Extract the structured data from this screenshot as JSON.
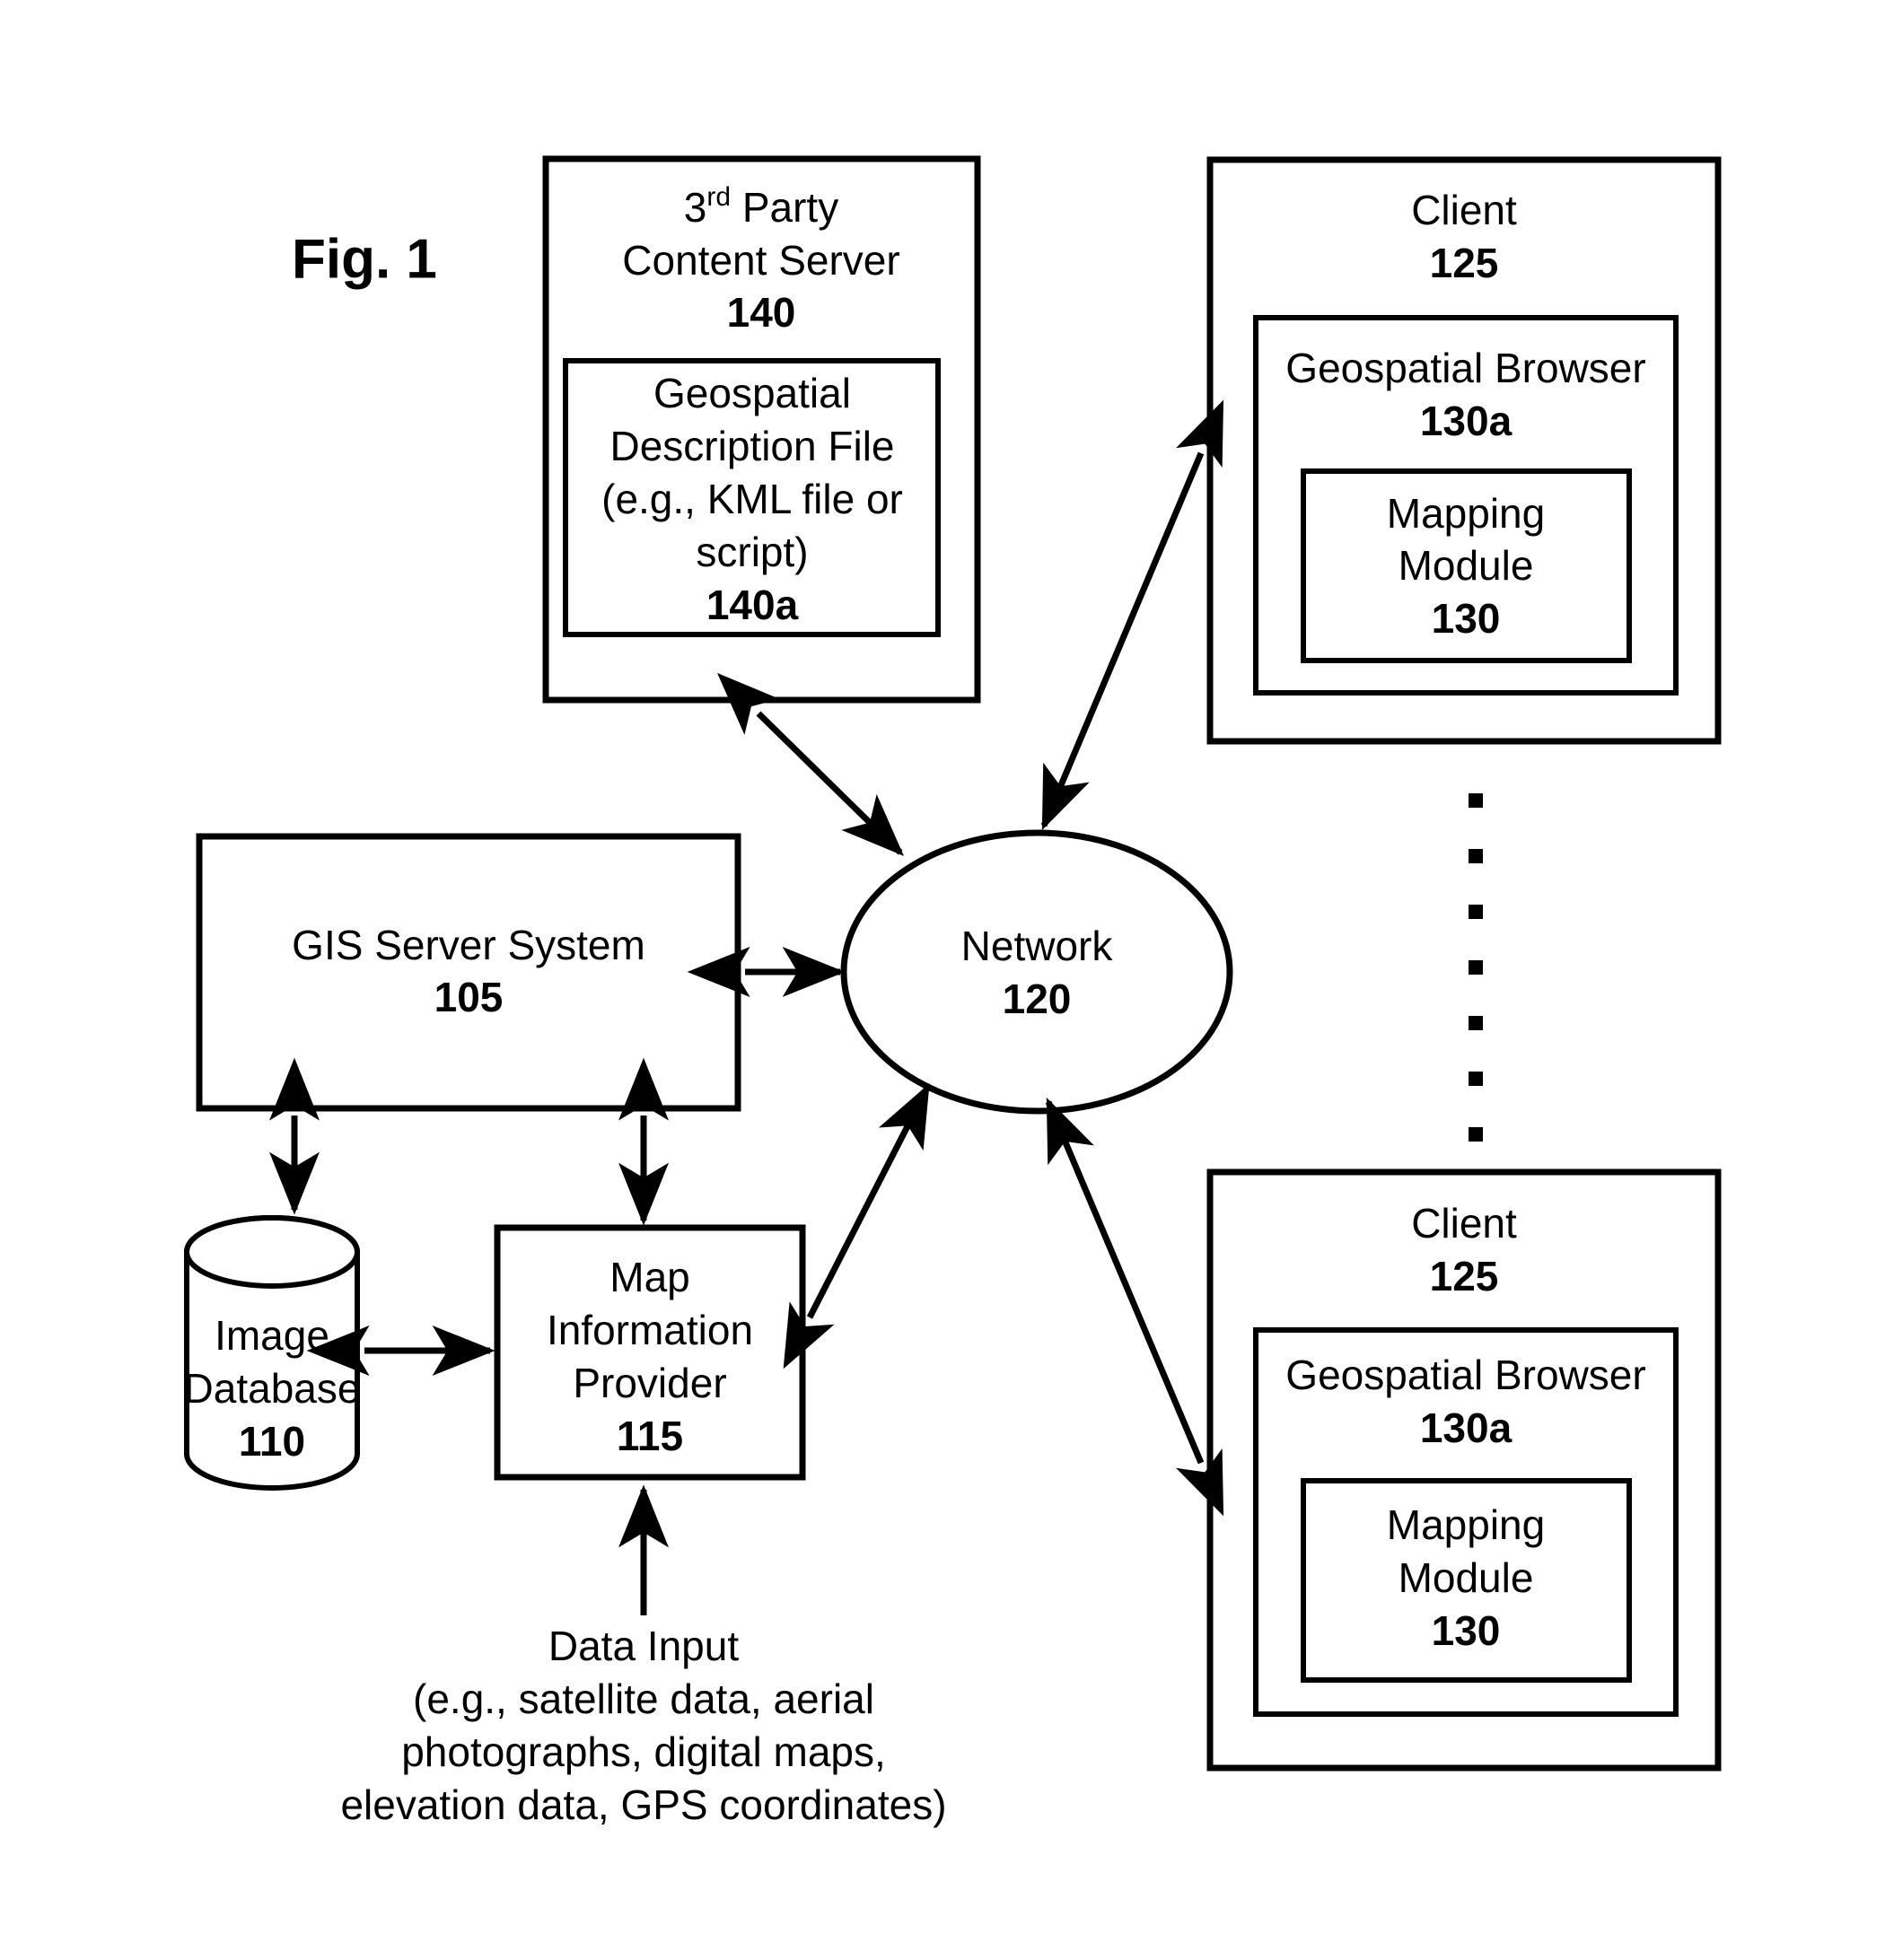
{
  "figure": {
    "title": "Fig. 1"
  },
  "nodes": {
    "content_server": {
      "name_line1_prefix": "3",
      "name_line1_sup": "rd",
      "name_line1_suffix": " Party",
      "name_line2": "Content Server",
      "ref": "140"
    },
    "description_file": {
      "line1": "Geospatial",
      "line2": "Description File",
      "line3": "(e.g., KML file or",
      "line4": "script)",
      "ref": "140a"
    },
    "gis_server": {
      "name": "GIS Server System",
      "ref": "105"
    },
    "image_database": {
      "line1": "Image",
      "line2": "Database",
      "ref": "110"
    },
    "map_information_provider": {
      "line1": "Map",
      "line2": "Information",
      "line3": "Provider",
      "ref": "115"
    },
    "network": {
      "name": "Network",
      "ref": "120"
    },
    "client_top": {
      "name": "Client",
      "ref": "125"
    },
    "geospatial_browser_top": {
      "name": "Geospatial Browser",
      "ref": "130a"
    },
    "mapping_module_top": {
      "line1": "Mapping",
      "line2": "Module",
      "ref": "130"
    },
    "client_bottom": {
      "name": "Client",
      "ref": "125"
    },
    "geospatial_browser_bottom": {
      "name": "Geospatial Browser",
      "ref": "130a"
    },
    "mapping_module_bottom": {
      "line1": "Mapping",
      "line2": "Module",
      "ref": "130"
    },
    "data_input": {
      "line1": "Data Input",
      "line2": "(e.g., satellite data, aerial",
      "line3": "photographs, digital maps,",
      "line4": "elevation data, GPS coordinates)"
    }
  },
  "ellipsis": {
    "count": 7
  },
  "colors": {
    "stroke": "#000000",
    "fill": "#ffffff",
    "text": "#000000"
  }
}
